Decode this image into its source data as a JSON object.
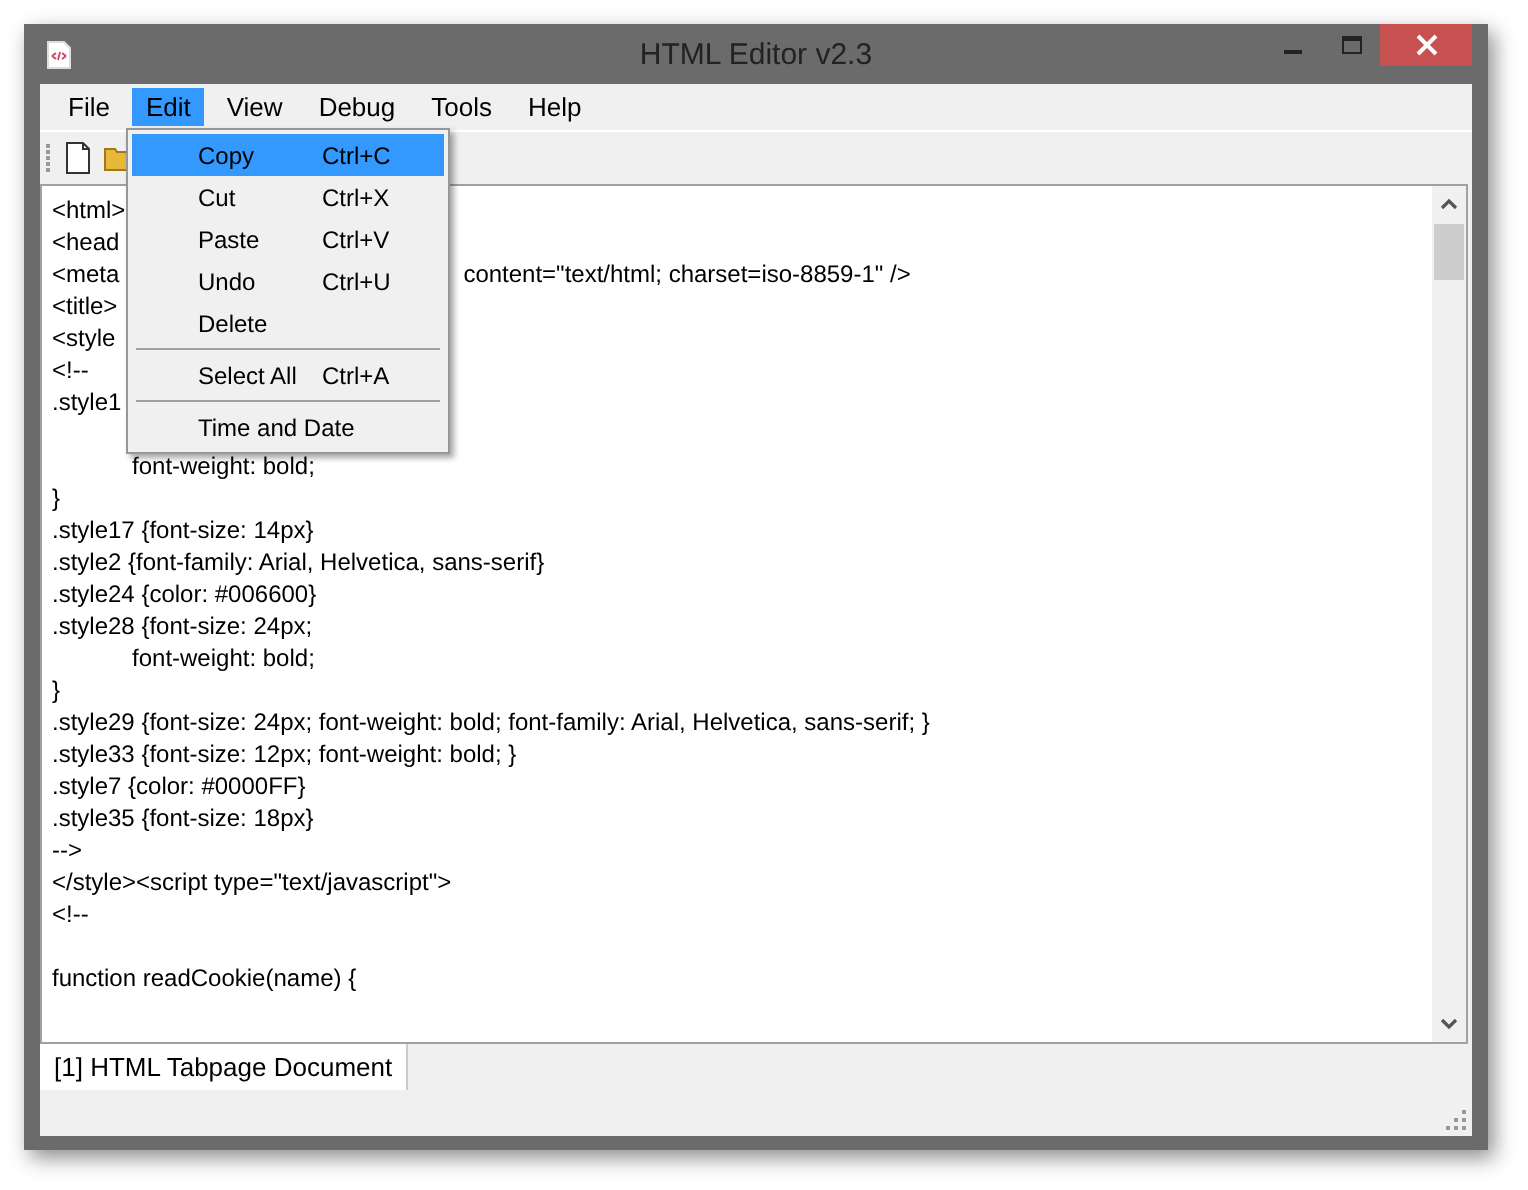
{
  "window": {
    "title": "HTML Editor v2.3"
  },
  "menu_bar": [
    {
      "label": "File",
      "selected": false
    },
    {
      "label": "Edit",
      "selected": true
    },
    {
      "label": "View",
      "selected": false
    },
    {
      "label": "Debug",
      "selected": false
    },
    {
      "label": "Tools",
      "selected": false
    },
    {
      "label": "Help",
      "selected": false
    }
  ],
  "edit_menu": [
    {
      "kind": "item",
      "label": "Copy",
      "shortcut": "Ctrl+C",
      "selected": true
    },
    {
      "kind": "item",
      "label": "Cut",
      "shortcut": "Ctrl+X",
      "selected": false
    },
    {
      "kind": "item",
      "label": "Paste",
      "shortcut": "Ctrl+V",
      "selected": false
    },
    {
      "kind": "item",
      "label": "Undo",
      "shortcut": "Ctrl+U",
      "selected": false
    },
    {
      "kind": "item",
      "label": "Delete",
      "selected": false
    },
    {
      "kind": "separator"
    },
    {
      "kind": "item",
      "label": "Select All",
      "shortcut": "Ctrl+A",
      "selected": false
    },
    {
      "kind": "separator"
    },
    {
      "kind": "item",
      "label": "Time and Date",
      "selected": false
    }
  ],
  "editor": {
    "lines": [
      {
        "text": "<html>"
      },
      {
        "text": "<head"
      },
      {
        "text": "<meta",
        "tail": "content=\"text/html; charset=iso-8859-1\" />"
      },
      {
        "text": "<title>"
      },
      {
        "text": "<style"
      },
      {
        "text": "<!--"
      },
      {
        "text": ".style1"
      },
      {
        "text": "            font-weight: bold;",
        "gap_before": true
      },
      {
        "text": "}"
      },
      {
        "text": ".style17 {font-size: 14px}"
      },
      {
        "text": ".style2 {font-family: Arial, Helvetica, sans-serif}"
      },
      {
        "text": ".style24 {color: #006600}"
      },
      {
        "text": ".style28 {font-size: 24px;"
      },
      {
        "text": "            font-weight: bold;"
      },
      {
        "text": "}"
      },
      {
        "text": ".style29 {font-size: 24px; font-weight: bold; font-family: Arial, Helvetica, sans-serif; }"
      },
      {
        "text": ".style33 {font-size: 12px; font-weight: bold; }"
      },
      {
        "text": ".style7 {color: #0000FF}"
      },
      {
        "text": ".style35 {font-size: 18px}"
      },
      {
        "text": "-->"
      },
      {
        "text": "</style><script type=\"text/javascript\">"
      },
      {
        "text": "<!--"
      },
      {
        "text": "function readCookie(name) {",
        "gap_before": true
      }
    ]
  },
  "tabs": [
    {
      "label": "[1] HTML Tabpage Document",
      "selected": true
    }
  ]
}
